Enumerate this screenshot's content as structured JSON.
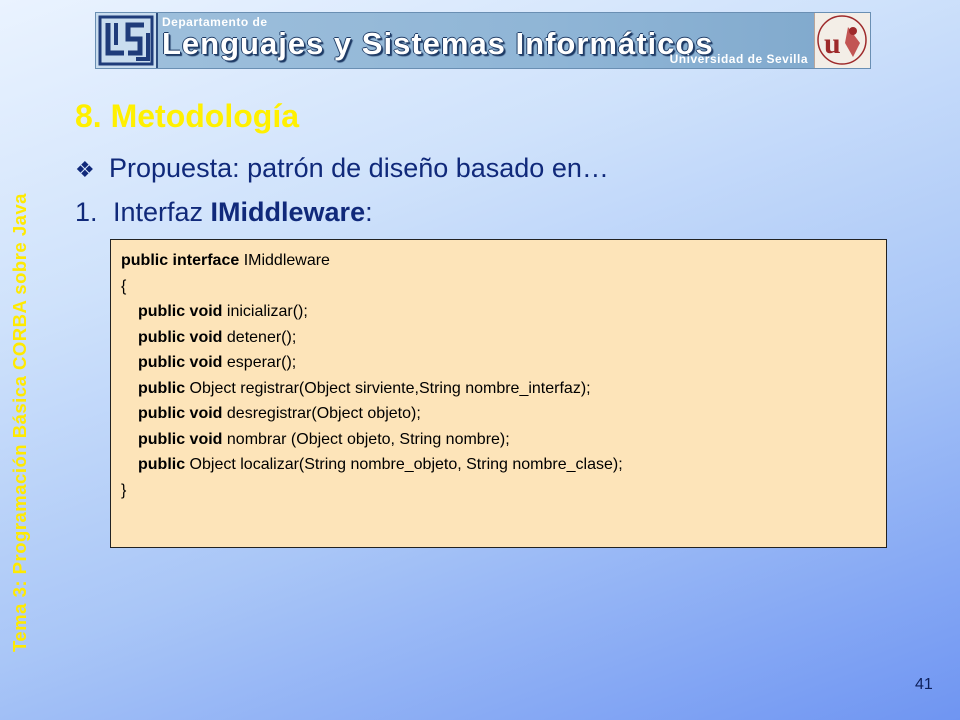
{
  "banner": {
    "department_small": "Departamento de",
    "department_name": "Lenguajes y Sistemas Informáticos",
    "university": "Universidad de Sevilla"
  },
  "side_title": "Tema 3: Programación Básica CORBA sobre Java",
  "section_title": "8. Metodología",
  "bullet": {
    "icon": "diamond-bullet-icon",
    "text": "Propuesta: patrón de diseño basado en…"
  },
  "numbered_item": {
    "number": "1.",
    "prefix": "Interfaz ",
    "bold": "IMiddleware",
    "suffix": ":"
  },
  "code": {
    "lines": [
      {
        "kw": "public interface",
        "rest": " IMiddleware",
        "indent": false
      },
      {
        "kw": "",
        "rest": "{",
        "indent": false
      },
      {
        "kw": "public void",
        "rest": " inicializar();",
        "indent": true
      },
      {
        "kw": "public void",
        "rest": " detener();",
        "indent": true
      },
      {
        "kw": "public void",
        "rest": " esperar();",
        "indent": true
      },
      {
        "kw": "public",
        "rest": " Object registrar(Object sirviente,String nombre_interfaz);",
        "indent": true
      },
      {
        "kw": "public void",
        "rest": " desregistrar(Object objeto);",
        "indent": true
      },
      {
        "kw": "public void",
        "rest": " nombrar (Object objeto, String nombre);",
        "indent": true
      },
      {
        "kw": "public",
        "rest": " Object localizar(String nombre_objeto, String nombre_clase);",
        "indent": true
      },
      {
        "kw": "",
        "rest": "}",
        "indent": false
      }
    ],
    "background": "#fde4b9"
  },
  "page_number": "41",
  "colors": {
    "title": "#fff000",
    "side_title": "#ffea00",
    "body_text": "#10297a"
  }
}
